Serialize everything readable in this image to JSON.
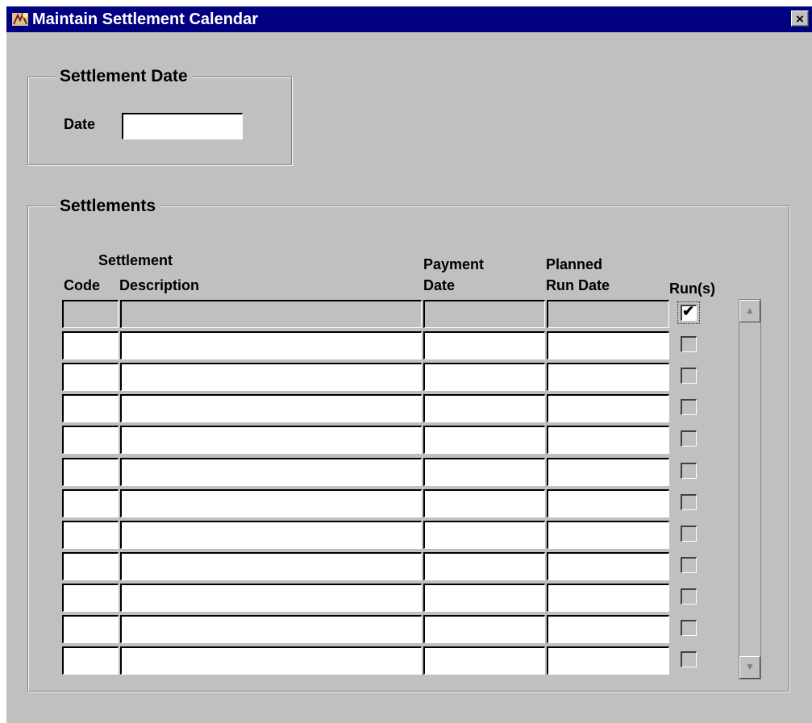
{
  "window": {
    "title": "Maintain Settlement Calendar",
    "close_label": "×"
  },
  "settlement_date": {
    "group_title": "Settlement Date",
    "date_label": "Date",
    "date_value": ""
  },
  "settlements": {
    "group_title": "Settlements",
    "headers": {
      "settlement": "Settlement",
      "code": "Code",
      "description": "Description",
      "payment": "Payment",
      "payment_date": "Date",
      "planned": "Planned",
      "run_date": "Run Date",
      "runs": "Run(s)"
    },
    "rows": [
      {
        "code": "",
        "description": "",
        "payment_date": "",
        "planned_run_date": "",
        "run": true
      },
      {
        "code": "",
        "description": "",
        "payment_date": "",
        "planned_run_date": "",
        "run": false
      },
      {
        "code": "",
        "description": "",
        "payment_date": "",
        "planned_run_date": "",
        "run": false
      },
      {
        "code": "",
        "description": "",
        "payment_date": "",
        "planned_run_date": "",
        "run": false
      },
      {
        "code": "",
        "description": "",
        "payment_date": "",
        "planned_run_date": "",
        "run": false
      },
      {
        "code": "",
        "description": "",
        "payment_date": "",
        "planned_run_date": "",
        "run": false
      },
      {
        "code": "",
        "description": "",
        "payment_date": "",
        "planned_run_date": "",
        "run": false
      },
      {
        "code": "",
        "description": "",
        "payment_date": "",
        "planned_run_date": "",
        "run": false
      },
      {
        "code": "",
        "description": "",
        "payment_date": "",
        "planned_run_date": "",
        "run": false
      },
      {
        "code": "",
        "description": "",
        "payment_date": "",
        "planned_run_date": "",
        "run": false
      },
      {
        "code": "",
        "description": "",
        "payment_date": "",
        "planned_run_date": "",
        "run": false
      },
      {
        "code": "",
        "description": "",
        "payment_date": "",
        "planned_run_date": "",
        "run": false
      }
    ]
  },
  "scrollbar": {
    "up_icon": "triangle-up-icon",
    "down_icon": "triangle-down-icon"
  }
}
